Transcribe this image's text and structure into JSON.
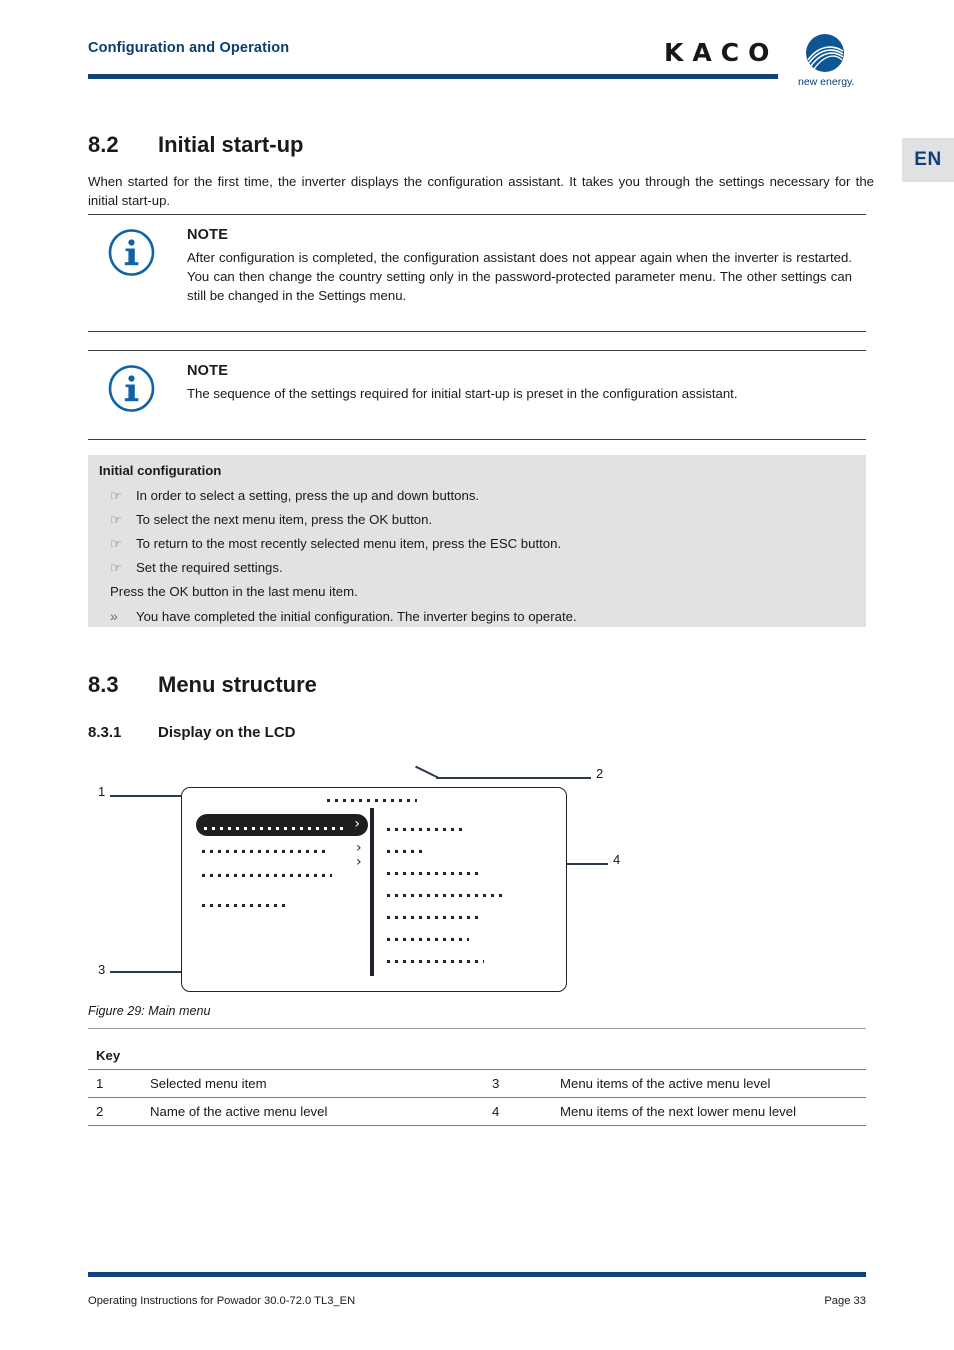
{
  "header": {
    "title": "Configuration and Operation",
    "logo_word": "KACO",
    "logo_tagline": "new energy.",
    "rule_color": "#104279"
  },
  "language_tab": {
    "label": "EN"
  },
  "sections": {
    "s82": {
      "number": "8.2",
      "title": "Initial start-up"
    },
    "s83": {
      "number": "8.3",
      "title": "Menu structure"
    },
    "s831": {
      "number": "8.3.1",
      "title": "Display on the LCD"
    }
  },
  "intro": "When started for the first time, the inverter displays the configuration assistant. It takes you through the settings necessary for the initial start-up.",
  "notes": [
    {
      "title": "NOTE",
      "text": "After configuration is completed, the configuration assistant does not appear again when the inverter is restarted. You can then change the country setting only in the password-protected parameter menu. The other settings can still be changed in the Settings menu."
    },
    {
      "title": "NOTE",
      "text": "The sequence of the settings required for initial start-up is preset in the configuration assistant."
    }
  ],
  "procedure": {
    "title": "Initial configuration",
    "steps": [
      {
        "marker": "☞",
        "text": "In order to select a setting, press the up and down buttons."
      },
      {
        "marker": "☞",
        "text": "To select the next menu item, press the OK button."
      },
      {
        "marker": "☞",
        "text": "To return to the most recently selected menu item, press the ESC button."
      },
      {
        "marker": "☞",
        "text": "Set the required settings."
      },
      {
        "marker": "",
        "text": "Press the OK button in the last menu item."
      },
      {
        "marker": "»",
        "text": "You have completed the initial configuration. The inverter begins to operate."
      }
    ]
  },
  "figure": {
    "caption": "Figure 29: Main menu",
    "callouts": [
      "1",
      "2",
      "3",
      "4"
    ],
    "lcd": {
      "active_level_dots_width": 90,
      "left_menu": [
        {
          "selected": true,
          "dots_width": 140,
          "chevron": "›"
        },
        {
          "selected": false,
          "dots_width": 124,
          "chevron": "›"
        },
        {
          "selected": false,
          "dots_width": 130,
          "chevron": "›"
        },
        {
          "selected": false,
          "dots_width": 86,
          "chevron": ""
        }
      ],
      "right_menu_dots_widths": [
        77,
        38,
        95,
        118,
        91,
        82,
        97
      ]
    }
  },
  "key": {
    "title": "Key",
    "rows": [
      {
        "n1": "1",
        "t1": "Selected menu item",
        "n2": "3",
        "t2": "Menu items of the active menu level"
      },
      {
        "n1": "2",
        "t1": "Name of the active menu level",
        "n2": "4",
        "t2": "Menu items of the next lower menu level"
      }
    ]
  },
  "footer": {
    "left": "Operating Instructions for Powador 30.0-72.0 TL3_EN",
    "right": "Page 33"
  }
}
